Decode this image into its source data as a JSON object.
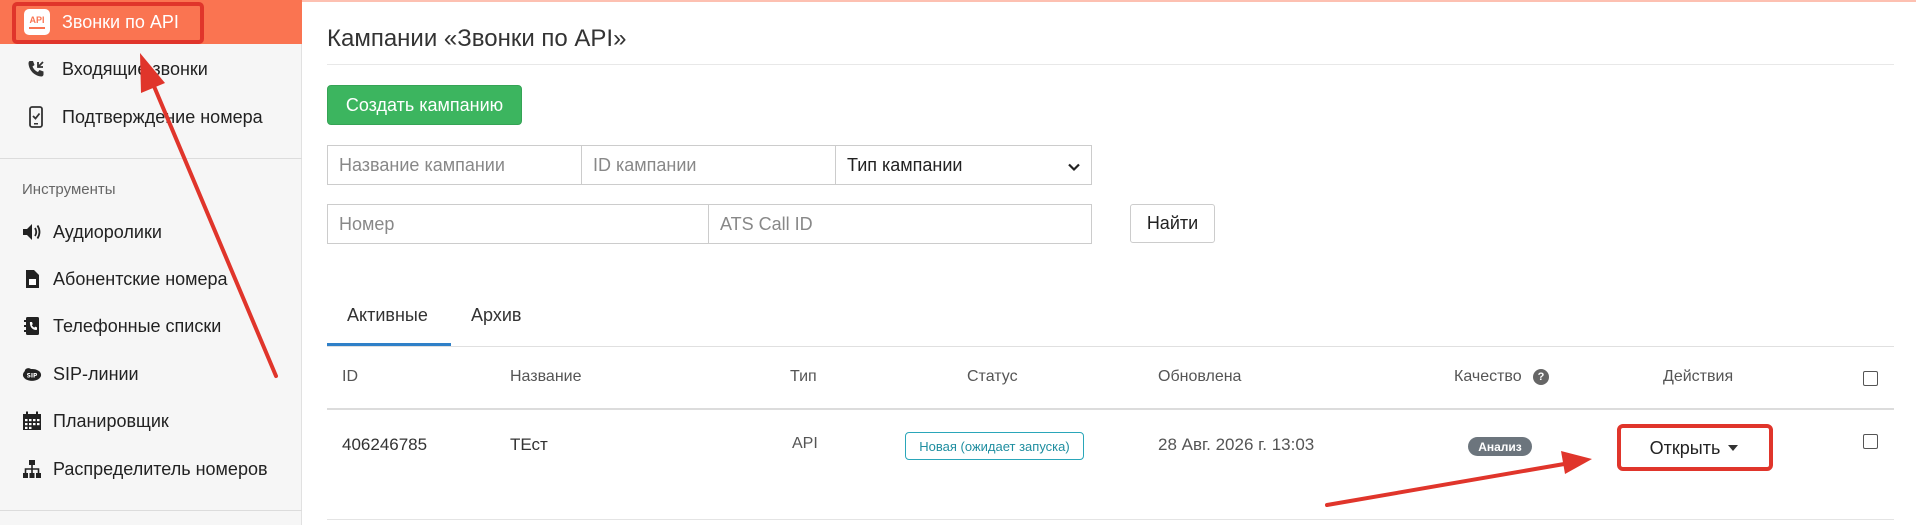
{
  "sidebar": {
    "active_item": {
      "label": "Звонки по API",
      "icon": "api-icon"
    },
    "items": [
      {
        "label": "Входящие звонки",
        "icon": "phone-incoming-icon"
      },
      {
        "label": "Подтверждение номера",
        "icon": "phone-check-icon"
      }
    ],
    "section_title": "Инструменты",
    "tools": [
      {
        "label": "Аудиоролики",
        "icon": "speaker-icon"
      },
      {
        "label": "Абонентские номера",
        "icon": "sim-card-icon"
      },
      {
        "label": "Телефонные списки",
        "icon": "address-book-icon"
      },
      {
        "label": "SIP-линии",
        "icon": "sip-icon"
      },
      {
        "label": "Планировщик",
        "icon": "calendar-icon"
      },
      {
        "label": "Распределитель номеров",
        "icon": "sitemap-icon"
      }
    ]
  },
  "page": {
    "title": "Кампании «Звонки по API»",
    "create_button": "Создать кампанию"
  },
  "filters": {
    "name_placeholder": "Название кампании",
    "id_placeholder": "ID кампании",
    "type_select": "Тип кампании",
    "number_placeholder": "Номер",
    "ats_placeholder": "ATS Call ID",
    "find_button": "Найти"
  },
  "tabs": [
    {
      "label": "Активные",
      "active": true
    },
    {
      "label": "Архив",
      "active": false
    }
  ],
  "table": {
    "headers": {
      "id": "ID",
      "name": "Название",
      "type": "Тип",
      "status": "Статус",
      "updated": "Обновлена",
      "quality": "Качество",
      "actions": "Действия"
    },
    "rows": [
      {
        "id": "406246785",
        "name": "ТЕст",
        "type": "API",
        "status": "Новая (ожидает запуска)",
        "updated": "28 Авг. 2026 г. 13:03",
        "quality": "Анализ",
        "action": "Открыть"
      }
    ]
  },
  "colors": {
    "accent": "#fa7451",
    "create_green": "#3cb55f",
    "annotation_red": "#e0352b",
    "status_teal": "#2aa6b9",
    "tab_blue": "#2f80c8"
  }
}
